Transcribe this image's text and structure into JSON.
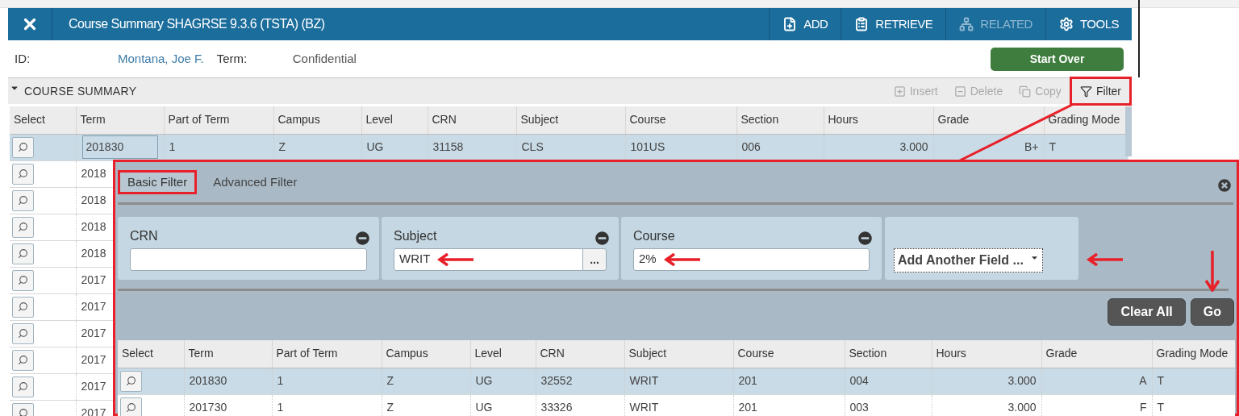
{
  "window": {
    "title": "Course Summary SHAGRSE 9.3.6 (TSTA) (BZ)",
    "toolbar": [
      {
        "kind": "add",
        "label": "ADD",
        "disabled": false
      },
      {
        "kind": "retrieve",
        "label": "RETRIEVE",
        "disabled": false
      },
      {
        "kind": "related",
        "label": "RELATED",
        "disabled": true
      },
      {
        "kind": "tools",
        "label": "TOOLS",
        "disabled": false
      }
    ]
  },
  "header": {
    "id_label": "ID:",
    "id_value": "Montana, Joe F.",
    "term_label": "Term:",
    "term_value": "Confidential",
    "start_over": "Start Over"
  },
  "section": {
    "title": "COURSE SUMMARY",
    "expanded": true,
    "actions": [
      {
        "kind": "insert",
        "label": "Insert",
        "disabled": true,
        "highlighted": false
      },
      {
        "kind": "delete",
        "label": "Delete",
        "disabled": true,
        "highlighted": false
      },
      {
        "kind": "copy",
        "label": "Copy",
        "disabled": true,
        "highlighted": false
      },
      {
        "kind": "filter",
        "label": "Filter",
        "disabled": false,
        "highlighted": true
      }
    ]
  },
  "table": {
    "columns": [
      "Select",
      "Term",
      "Part of Term",
      "Campus",
      "Level",
      "CRN",
      "Subject",
      "Course",
      "Section",
      "Hours",
      "Grade",
      "Grading Mode"
    ],
    "rows": [
      {
        "selected": true,
        "cells": [
          "",
          "201830",
          "1",
          "Z",
          "UG",
          "31158",
          "CLS",
          "101US",
          "006",
          "3.000",
          "B+",
          "T"
        ]
      },
      {
        "selected": false,
        "cells": [
          "",
          "2018"
        ]
      },
      {
        "selected": false,
        "cells": [
          "",
          "2018"
        ]
      },
      {
        "selected": false,
        "cells": [
          "",
          "2018"
        ]
      },
      {
        "selected": false,
        "cells": [
          "",
          "2018"
        ]
      },
      {
        "selected": false,
        "cells": [
          "",
          "2017"
        ]
      },
      {
        "selected": false,
        "cells": [
          "",
          "2017"
        ]
      },
      {
        "selected": false,
        "cells": [
          "",
          "2017"
        ]
      },
      {
        "selected": false,
        "cells": [
          "",
          "2017"
        ]
      },
      {
        "selected": false,
        "cells": [
          "",
          "2017"
        ]
      },
      {
        "selected": false,
        "cells": [
          "",
          "2017"
        ]
      }
    ]
  },
  "filter": {
    "tabs": [
      {
        "label": "Basic Filter",
        "selected": true,
        "highlighted": true
      },
      {
        "label": "Advanced Filter",
        "selected": false,
        "highlighted": false
      }
    ],
    "fields": [
      {
        "kind": "text",
        "label": "CRN",
        "callout": false
      },
      {
        "kind": "lookup",
        "label": "Subject",
        "value": "WRIT",
        "lookup_label": "...",
        "callout": true
      },
      {
        "kind": "text",
        "label": "Course",
        "value": "2%",
        "callout": true
      }
    ],
    "add_field": {
      "label": "Add Another Field ...",
      "callout": true
    },
    "buttons": [
      {
        "label": "Clear All",
        "callout": false
      },
      {
        "label": "Go",
        "callout": true
      }
    ],
    "table": {
      "columns": [
        "Select",
        "Term",
        "Part of Term",
        "Campus",
        "Level",
        "CRN",
        "Subject",
        "Course",
        "Section",
        "Hours",
        "Grade",
        "Grading Mode"
      ],
      "rows": [
        {
          "selected": true,
          "cells": [
            "",
            "201830",
            "1",
            "Z",
            "UG",
            "32552",
            "WRIT",
            "201",
            "004",
            "3.000",
            "A",
            "T"
          ]
        },
        {
          "selected": false,
          "cells": [
            "",
            "201730",
            "1",
            "Z",
            "UG",
            "33326",
            "WRIT",
            "201",
            "003",
            "3.000",
            "F",
            "T"
          ]
        }
      ]
    }
  }
}
